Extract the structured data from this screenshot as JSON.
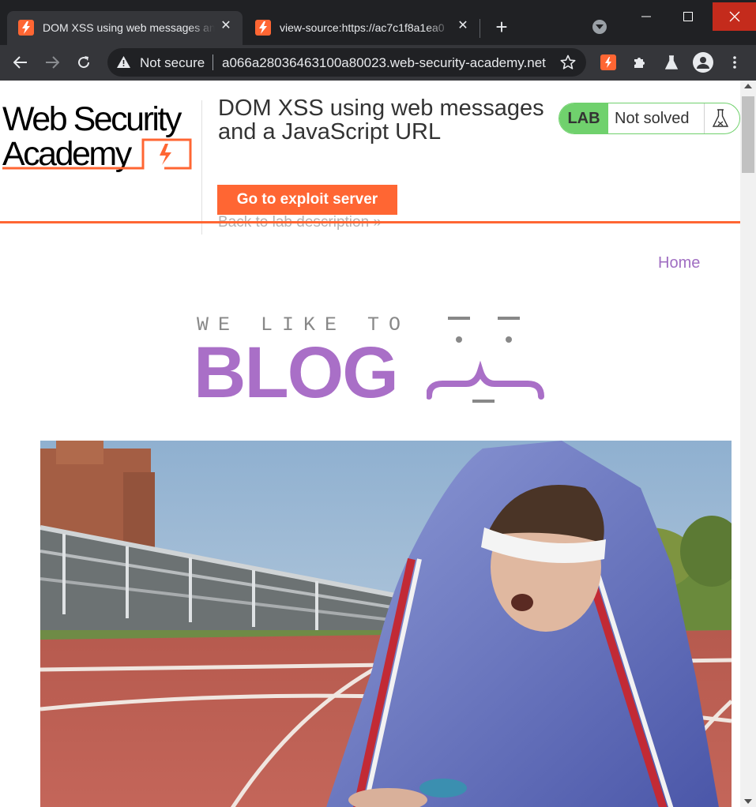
{
  "browser": {
    "tabs": [
      {
        "title": "DOM XSS using web messages and a JavaScript URL",
        "active": true
      },
      {
        "title": "view-source:https://ac7c1f8a1ea0",
        "active": false
      }
    ],
    "security_label": "Not secure",
    "url": "a066a28036463100a80023.web-security-academy.net"
  },
  "header": {
    "logo_line1": "Web Security",
    "logo_line2": "Academy",
    "lab_title": "DOM XSS using web messages and a JavaScript URL",
    "exploit_button": "Go to exploit server",
    "back_link": "Back to lab description",
    "lab_badge": "LAB",
    "lab_status": "Not solved"
  },
  "nav": {
    "home": "Home"
  },
  "banner": {
    "tagline": "WE LIKE TO",
    "word": "BLOG"
  },
  "colors": {
    "accent_orange": "#ff6633",
    "lab_green": "#70d16d",
    "blog_purple": "#a96fc7",
    "link_purple": "#a06ec2"
  }
}
